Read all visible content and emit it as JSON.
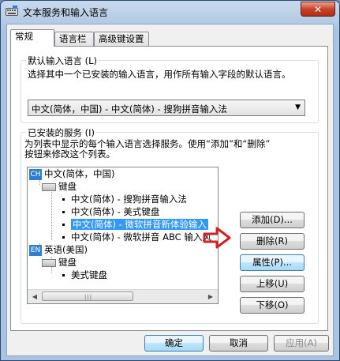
{
  "window": {
    "title": "文本服务和输入语言",
    "close_label": "✕"
  },
  "tabs": [
    {
      "label": "常规",
      "active": true
    },
    {
      "label": "语言栏",
      "active": false
    },
    {
      "label": "高级键设置",
      "active": false
    }
  ],
  "default_language": {
    "label": "默认输入语言 (L)",
    "description": "选择其中一个已安装的输入语言，用作所有输入字段的默认语言。",
    "selected": "中文(简体，中国) - 中文(简体) - 搜狗拼音输入法"
  },
  "installed_services": {
    "label": "已安装的服务 (I)",
    "description_line1": "为列表中显示的每个输入语言选择服务。使用“添加”和“删除”",
    "description_line2": "按钮来修改这个列表。",
    "tree": {
      "lang_cn": {
        "badge": "CH",
        "label": "中文(简体，中国)"
      },
      "cn_keyboard": "键盘",
      "cn_items": [
        "中文(简体) - 搜狗拼音输入法",
        "中文(简体) - 美式键盘",
        "中文(简体) - 微软拼音新体验输入",
        "中文(简体) - 微软拼音 ABC 输入风"
      ],
      "selected_index": 2,
      "lang_en": {
        "badge": "EN",
        "label": "英语(美国)"
      },
      "en_keyboard": "键盘",
      "en_items": [
        "美式键盘"
      ]
    },
    "buttons": {
      "add": "添加(D)...",
      "remove": "删除(R)",
      "properties": "属性(P)...",
      "move_up": "上移(U)",
      "move_down": "下移(O)"
    }
  },
  "footer": {
    "ok": "确定",
    "cancel": "取消",
    "apply": "应用(A)"
  },
  "colors": {
    "accent_arrow": "#d21f1f",
    "selection": "#3399ff"
  }
}
